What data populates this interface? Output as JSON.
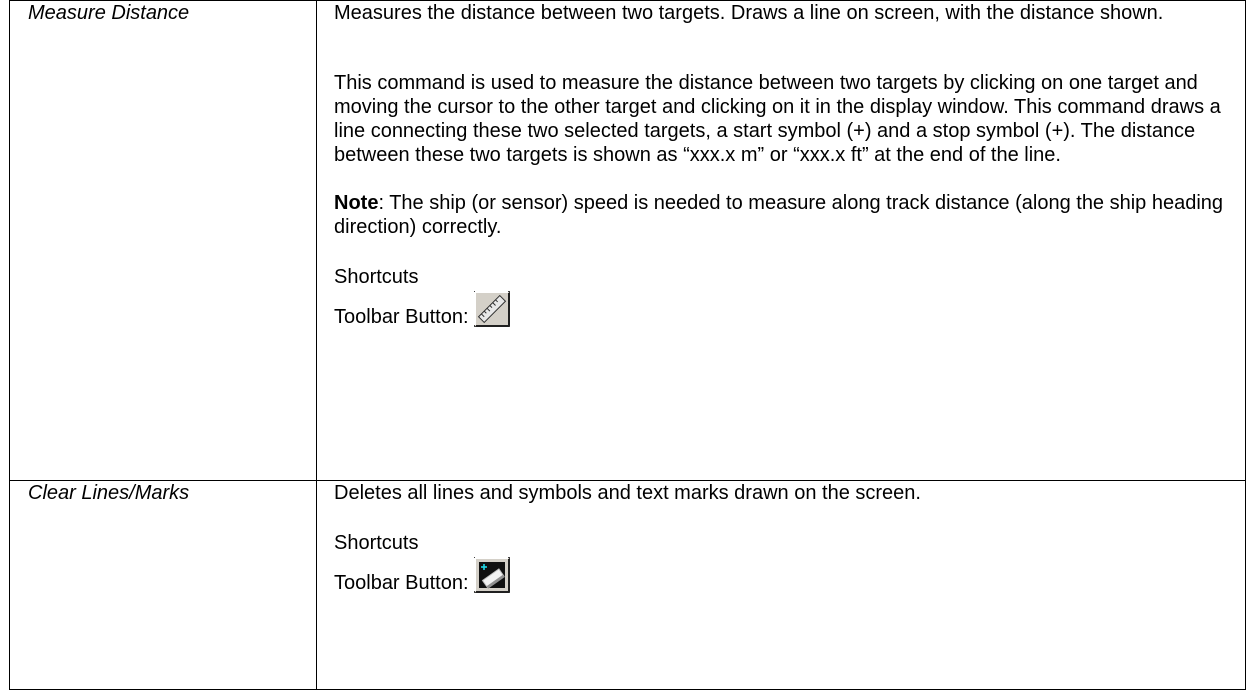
{
  "rows": [
    {
      "command": "Measure Distance",
      "summary": "Measures the distance between two targets. Draws a line on screen, with the distance shown.",
      "details": "This command is used to measure the distance between two targets by clicking on one target and moving the cursor to the other target and clicking on it in the display window. This command draws a line connecting these two selected targets, a start symbol (+) and a stop symbol (+). The distance between these two targets is shown as “xxx.x m” or “xxx.x ft” at the end of the line.",
      "note_label": "Note",
      "note_text": ": The ship (or sensor) speed is needed to measure along track distance (along the ship heading direction) correctly.",
      "shortcuts_label": "Shortcuts",
      "toolbar_label": "Toolbar Button:",
      "icon": "ruler-icon"
    },
    {
      "command": "Clear Lines/Marks",
      "summary": "Deletes all lines and symbols and text marks drawn on the screen.",
      "shortcuts_label": "Shortcuts",
      "toolbar_label": "Toolbar Button:",
      "icon": "eraser-icon"
    }
  ]
}
